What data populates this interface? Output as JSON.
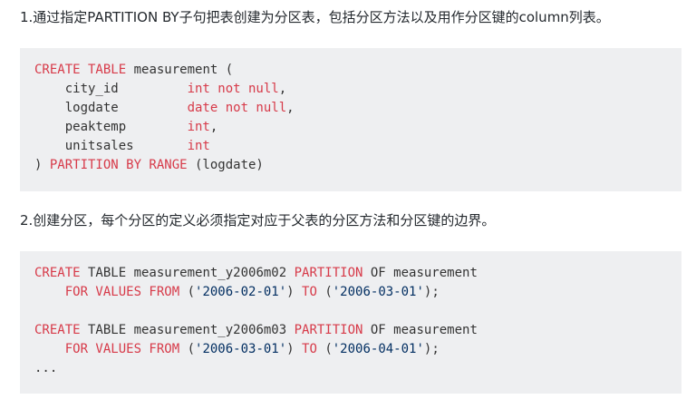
{
  "paragraphs": {
    "p1": "1.通过指定PARTITION BY子句把表创建为分区表，包括分区方法以及用作分区键的column列表。",
    "p2": "2.创建分区，每个分区的定义必须指定对应于父表的分区方法和分区键的边界。"
  },
  "code_blocks": [
    {
      "lines": [
        [
          {
            "t": "kw",
            "v": "CREATE TABLE"
          },
          {
            "t": "pl",
            "v": " measurement ("
          }
        ],
        [
          {
            "t": "pl",
            "v": "    city_id         "
          },
          {
            "t": "kw",
            "v": "int not null"
          },
          {
            "t": "pl",
            "v": ","
          }
        ],
        [
          {
            "t": "pl",
            "v": "    logdate         "
          },
          {
            "t": "kw",
            "v": "date not null"
          },
          {
            "t": "pl",
            "v": ","
          }
        ],
        [
          {
            "t": "pl",
            "v": "    peaktemp        "
          },
          {
            "t": "kw",
            "v": "int"
          },
          {
            "t": "pl",
            "v": ","
          }
        ],
        [
          {
            "t": "pl",
            "v": "    unitsales       "
          },
          {
            "t": "kw",
            "v": "int"
          }
        ],
        [
          {
            "t": "pl",
            "v": ") "
          },
          {
            "t": "kw",
            "v": "PARTITION BY RANGE"
          },
          {
            "t": "pl",
            "v": " (logdate)"
          }
        ]
      ]
    },
    {
      "lines": [
        [
          {
            "t": "kw",
            "v": "CREATE"
          },
          {
            "t": "pl",
            "v": " TABLE measurement_y2006m02 "
          },
          {
            "t": "kw",
            "v": "PARTITION"
          },
          {
            "t": "pl",
            "v": " OF measurement"
          }
        ],
        [
          {
            "t": "pl",
            "v": "    "
          },
          {
            "t": "kw",
            "v": "FOR VALUES FROM"
          },
          {
            "t": "pl",
            "v": " ("
          },
          {
            "t": "str",
            "v": "'2006-02-01'"
          },
          {
            "t": "pl",
            "v": ") "
          },
          {
            "t": "kw",
            "v": "TO"
          },
          {
            "t": "pl",
            "v": " ("
          },
          {
            "t": "str",
            "v": "'2006-03-01'"
          },
          {
            "t": "pl",
            "v": ");"
          }
        ],
        [],
        [
          {
            "t": "kw",
            "v": "CREATE"
          },
          {
            "t": "pl",
            "v": " TABLE measurement_y2006m03 "
          },
          {
            "t": "kw",
            "v": "PARTITION"
          },
          {
            "t": "pl",
            "v": " OF measurement"
          }
        ],
        [
          {
            "t": "pl",
            "v": "    "
          },
          {
            "t": "kw",
            "v": "FOR VALUES FROM"
          },
          {
            "t": "pl",
            "v": " ("
          },
          {
            "t": "str",
            "v": "'2006-03-01'"
          },
          {
            "t": "pl",
            "v": ") "
          },
          {
            "t": "kw",
            "v": "TO"
          },
          {
            "t": "pl",
            "v": " ("
          },
          {
            "t": "str",
            "v": "'2006-04-01'"
          },
          {
            "t": "pl",
            "v": ");"
          }
        ],
        [
          {
            "t": "pl",
            "v": "..."
          }
        ]
      ]
    }
  ],
  "colors": {
    "keyword": "#d73a49",
    "string": "#032f62",
    "plain": "#333333",
    "code_background": "#eeeff1"
  }
}
